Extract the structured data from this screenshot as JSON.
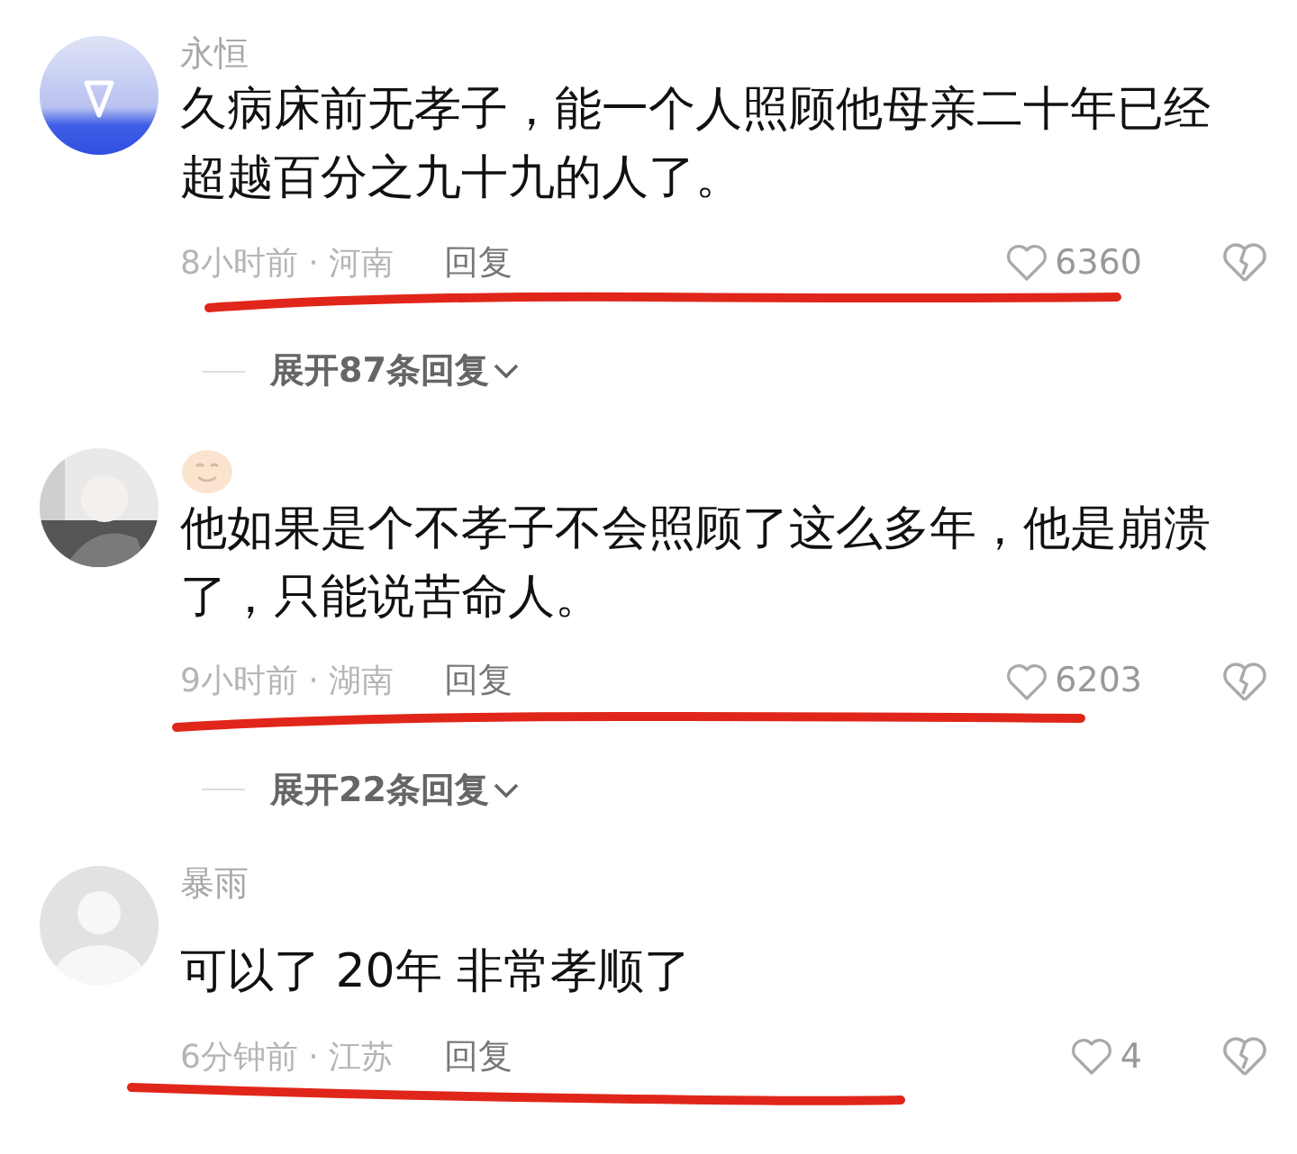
{
  "comments": [
    {
      "username": "永恒",
      "text": "久病床前无孝子，能一个人照顾他母亲二十年已经超越百分之九十九的人了。",
      "meta": "8小时前 · 河南",
      "reply": "回复",
      "likes": "6360",
      "expand": "展开87条回复",
      "underlined": true
    },
    {
      "text": "他如果是个不孝子不会照顾了这么多年，他是崩溃了，只能说苦命人。",
      "meta": "9小时前 · 湖南",
      "reply": "回复",
      "likes": "6203",
      "expand": "展开22条回复",
      "underlined": true
    },
    {
      "username": "暴雨",
      "text": "可以了 20年 非常孝顺了",
      "meta": "6分钟前 · 江苏",
      "reply": "回复",
      "likes": "4",
      "underlined": true
    }
  ]
}
